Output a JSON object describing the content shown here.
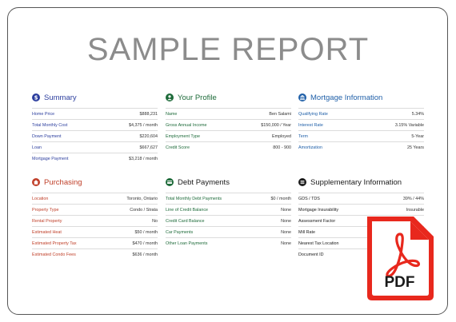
{
  "title": "SAMPLE REPORT",
  "colors": {
    "summary": "#2c3e9e",
    "profile": "#1e6b3a",
    "mortgage": "#1f5fa8",
    "purchasing": "#c0402a",
    "debt": "#1e6b3a",
    "supplementary": "#1a1a1a",
    "pdf": "#e8281d"
  },
  "sections": {
    "summary": {
      "title": "Summary",
      "icon": "dollar-icon",
      "rows": [
        {
          "label": "Home Price",
          "value": "$888,231"
        },
        {
          "label": "Total Monthly Cost",
          "value": "$4,375 / month"
        },
        {
          "label": "Down Payment",
          "value": "$220,604"
        },
        {
          "label": "Loan",
          "value": "$667,627"
        },
        {
          "label": "Mortgage Payment",
          "value": "$3,218 / month"
        }
      ]
    },
    "profile": {
      "title": "Your Profile",
      "icon": "person-icon",
      "rows": [
        {
          "label": "Name",
          "value": "Ben Salami"
        },
        {
          "label": "Gross Annual Income",
          "value": "$150,000 / Year"
        },
        {
          "label": "Employment Type",
          "value": "Employed"
        },
        {
          "label": "Credit Score",
          "value": "800 - 900"
        }
      ]
    },
    "mortgage": {
      "title": "Mortgage Information",
      "icon": "bank-icon",
      "rows": [
        {
          "label": "Qualifying Rate",
          "value": "5.34%"
        },
        {
          "label": "Interest Rate",
          "value": "3.15% Variable"
        },
        {
          "label": "Term",
          "value": "5-Year"
        },
        {
          "label": "Amortization",
          "value": "25 Years"
        }
      ]
    },
    "purchasing": {
      "title": "Purchasing",
      "icon": "home-icon",
      "rows": [
        {
          "label": "Location",
          "value": "Toronto, Ontario"
        },
        {
          "label": "Property Type",
          "value": "Condo / Strata"
        },
        {
          "label": "Rental Property",
          "value": "No"
        },
        {
          "label": "Estimated Heat",
          "value": "$50 / month"
        },
        {
          "label": "Estimated Property Tax",
          "value": "$470 / month"
        },
        {
          "label": "Estimated Condo Fees",
          "value": "$636 / month"
        }
      ]
    },
    "debt": {
      "title": "Debt Payments",
      "icon": "credit-card-icon",
      "rows": [
        {
          "label": "Total Monthly Debt Payments",
          "value": "$0 / month"
        },
        {
          "label": "Line of Credit Balance",
          "value": "None"
        },
        {
          "label": "Credit Card Balance",
          "value": "None"
        },
        {
          "label": "Car Payments",
          "value": "None"
        },
        {
          "label": "Other Loan Payments",
          "value": "None"
        }
      ]
    },
    "supplementary": {
      "title": "Supplementary Information",
      "icon": "list-icon",
      "rows": [
        {
          "label": "GDS / TDS",
          "value": "39% / 44%"
        },
        {
          "label": "Mortgage Insurability",
          "value": "Insurable"
        },
        {
          "label": "Assessment Factor",
          "value": ""
        },
        {
          "label": "Mill Rate",
          "value": ""
        },
        {
          "label": "Nearest Tax Location",
          "value": ""
        },
        {
          "label": "Document ID",
          "value": ""
        }
      ]
    }
  },
  "pdf_badge": {
    "label": "PDF",
    "icon": "pdf-acrobat-icon"
  }
}
